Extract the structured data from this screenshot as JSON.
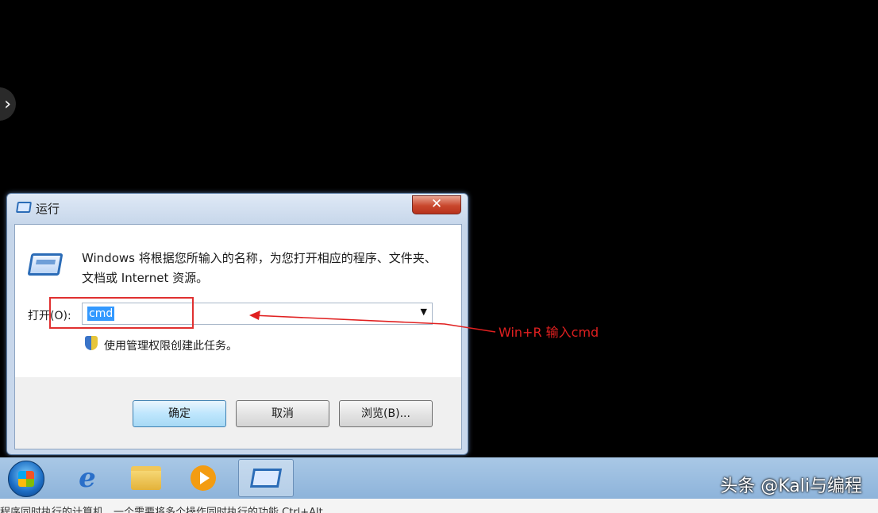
{
  "dialog": {
    "title": "运行",
    "close_label": "✕",
    "description": "Windows 将根据您所输入的名称，为您打开相应的程序、文件夹、文档或 Internet 资源。",
    "open_label": "打开(O):",
    "input_value": "cmd",
    "admin_note": "使用管理权限创建此任务。",
    "buttons": {
      "ok": "确定",
      "cancel": "取消",
      "browse": "浏览(B)..."
    }
  },
  "annotation": {
    "text": "Win+R  输入cmd",
    "color": "#e02020"
  },
  "watermark": "头条 @Kali与编程",
  "bottom_text": "程序同时执行的计算机，一个需要将多个操作同时执行的功能 Ctrl+Alt",
  "taskbar": {
    "items": [
      "start-orb",
      "ie-icon",
      "folder-icon",
      "media-player-icon",
      "run-icon"
    ]
  }
}
